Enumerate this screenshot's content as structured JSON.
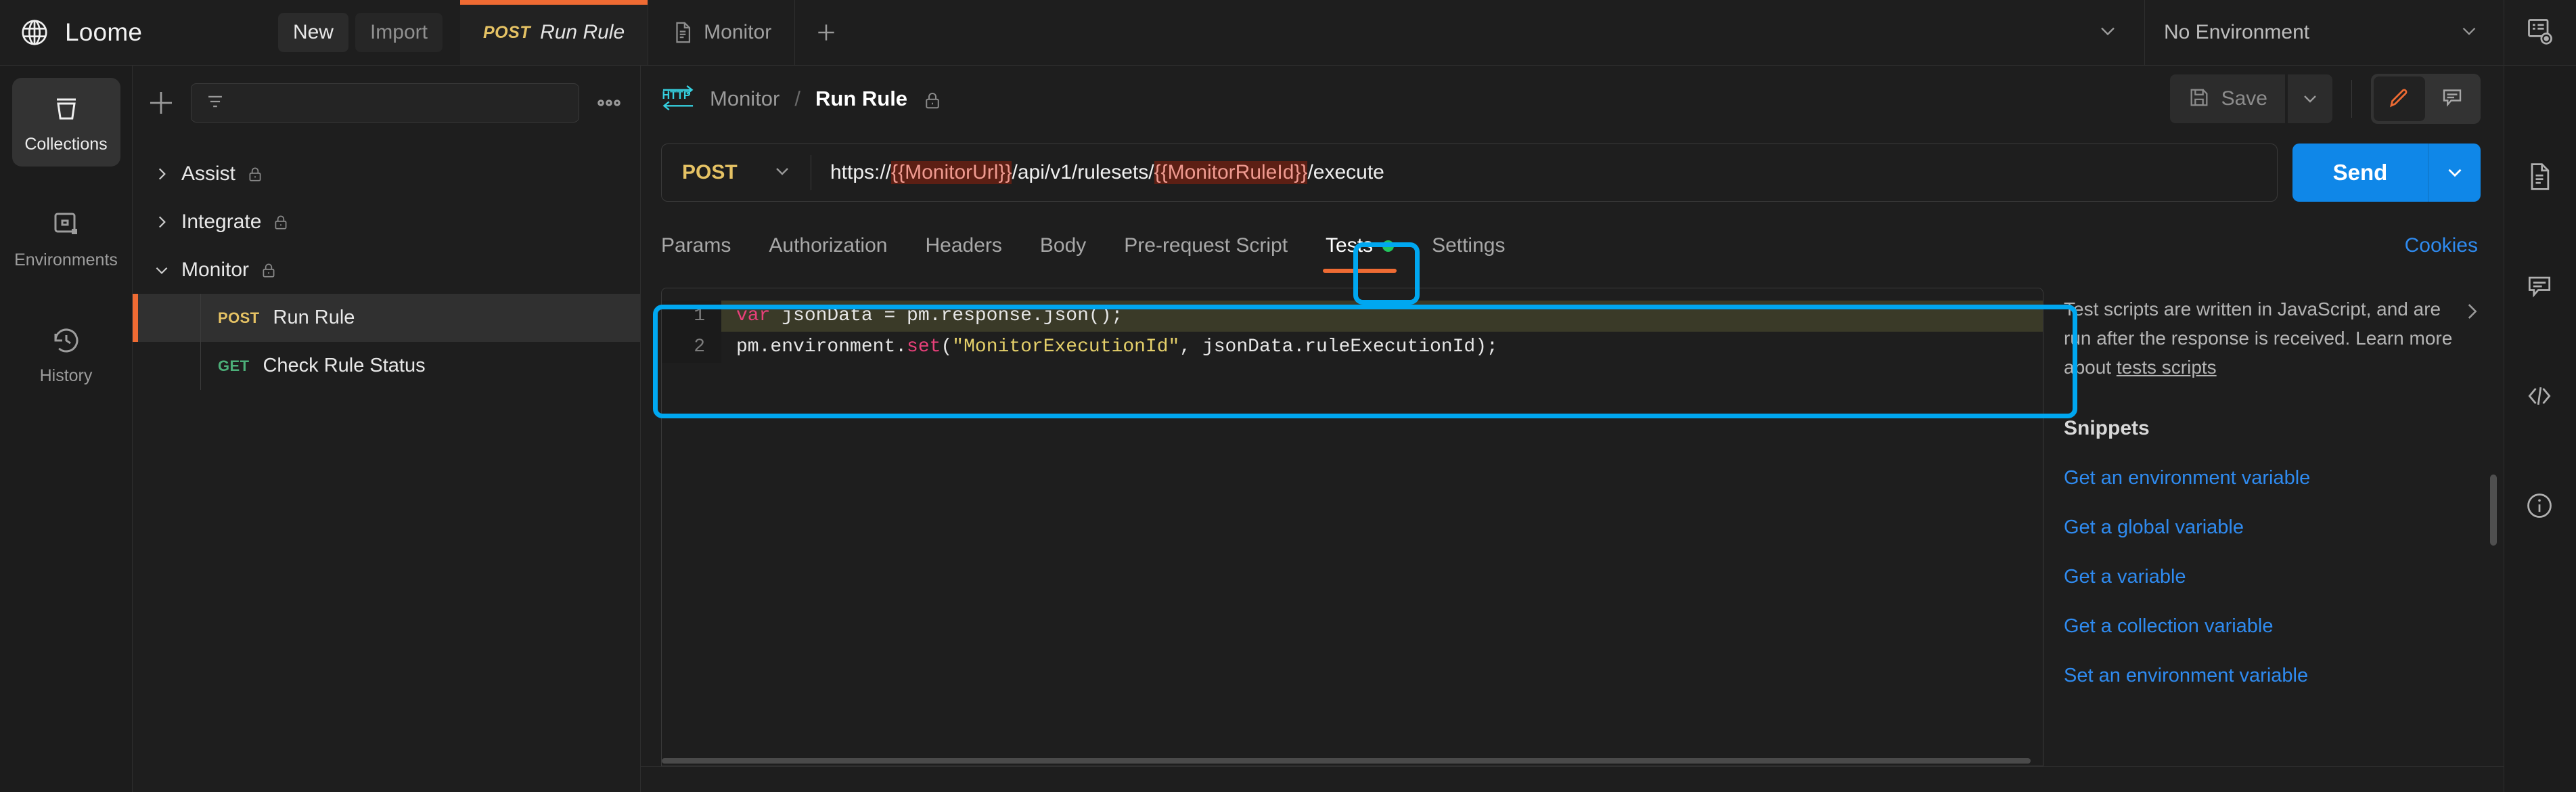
{
  "app": {
    "brand": "Loome",
    "logo_icon": "globe-icon"
  },
  "topbar": {
    "new_label": "New",
    "import_label": "Import",
    "add_tab_icon": "plus-icon",
    "tabs": [
      {
        "method": "POST",
        "title": "Run Rule",
        "active": true,
        "icon": ""
      },
      {
        "method": "",
        "title": "Monitor",
        "active": false,
        "icon": "document-icon"
      }
    ],
    "tabstrip_caret_icon": "chevron-down-icon",
    "environment": {
      "selected": "No Environment",
      "caret_icon": "chevron-down-icon"
    },
    "env_quick_look_icon": "environment-quick-look-icon"
  },
  "left_rail": {
    "items": [
      {
        "label": "Collections",
        "icon": "collections-icon",
        "active": true
      },
      {
        "label": "Environments",
        "icon": "environments-icon",
        "active": false
      },
      {
        "label": "History",
        "icon": "history-clock-icon",
        "active": false
      }
    ]
  },
  "sidebar": {
    "toolbar": {
      "new_icon": "plus-icon",
      "filter_icon": "filter-icon",
      "filter_placeholder": "",
      "more_icon": "ellipsis-icon"
    },
    "collections": [
      {
        "label": "Assist",
        "expanded": false,
        "locked": true,
        "chevron": "chevron-right-icon"
      },
      {
        "label": "Integrate",
        "expanded": false,
        "locked": true,
        "chevron": "chevron-right-icon"
      },
      {
        "label": "Monitor",
        "expanded": true,
        "locked": true,
        "chevron": "chevron-down-icon"
      }
    ],
    "requests": [
      {
        "method": "POST",
        "name": "Run Rule",
        "selected": true
      },
      {
        "method": "GET",
        "name": "Check Rule Status",
        "selected": false
      }
    ]
  },
  "request": {
    "type_icon": "http-icon",
    "breadcrumb_parent": "Monitor",
    "breadcrumb_sep": "/",
    "breadcrumb_current": "Run Rule",
    "lock_icon": "lock-icon",
    "save_label": "Save",
    "save_icon": "save-floppy-icon",
    "save_caret_icon": "chevron-down-icon",
    "mode_buttons": [
      {
        "icon": "pencil-edit-icon",
        "active": true
      },
      {
        "icon": "comment-icon",
        "active": false
      }
    ],
    "method": "POST",
    "method_caret_icon": "chevron-down-icon",
    "url_parts": [
      {
        "text": "https://",
        "variable": false
      },
      {
        "text": "{{MonitorUrl}}",
        "variable": true
      },
      {
        "text": "/api/v1/rulesets/",
        "variable": false
      },
      {
        "text": "{{MonitorRuleId}}",
        "variable": true
      },
      {
        "text": "/execute",
        "variable": false
      }
    ],
    "send_label": "Send",
    "send_caret_icon": "chevron-down-icon",
    "tabs": [
      {
        "label": "Params",
        "active": false,
        "dot": false
      },
      {
        "label": "Authorization",
        "active": false,
        "dot": false
      },
      {
        "label": "Headers",
        "active": false,
        "dot": false
      },
      {
        "label": "Body",
        "active": false,
        "dot": false
      },
      {
        "label": "Pre-request Script",
        "active": false,
        "dot": false
      },
      {
        "label": "Tests",
        "active": true,
        "dot": true
      },
      {
        "label": "Settings",
        "active": false,
        "dot": false
      }
    ],
    "cookies_label": "Cookies"
  },
  "editor": {
    "lines": [
      {
        "number": "1",
        "active": true
      },
      {
        "number": "2",
        "active": false
      }
    ],
    "line1": {
      "kw": "var",
      "rest": " jsonData = pm.response.json();"
    },
    "line2": {
      "pre": "pm.environment.",
      "fn": "set",
      "open": "(",
      "str": "\"MonitorExecutionId\"",
      "post": ", jsonData.ruleExecutionId);"
    }
  },
  "docs": {
    "description": "Test scripts are written in JavaScript, and are run after the response is received. Learn more about ",
    "link_text": "tests scripts",
    "expand_icon": "chevron-right-icon",
    "snippets_title": "Snippets",
    "snippets": [
      "Get an environment variable",
      "Get a global variable",
      "Get a variable",
      "Get a collection variable",
      "Set an environment variable"
    ]
  },
  "right_rail": {
    "items": [
      {
        "icon": "document-icon"
      },
      {
        "icon": "comment-icon"
      },
      {
        "icon": "code-icon"
      },
      {
        "icon": "info-icon"
      }
    ]
  },
  "annotations": [
    {
      "name": "tests-tab-highlight"
    },
    {
      "name": "tests-editor-highlight"
    }
  ],
  "colors": {
    "accent_orange": "#ef6b33",
    "send_blue": "#0f87e8",
    "link_blue": "#2f8bf0",
    "annotation_cyan": "#00a7f0",
    "method_post": "#e5c264",
    "method_get": "#4caf79",
    "variable_unresolved_bg": "#5c1f14"
  }
}
